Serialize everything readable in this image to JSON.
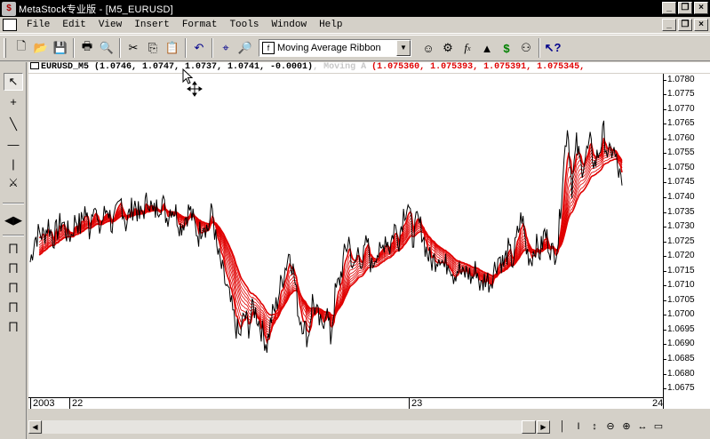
{
  "window": {
    "title": "MetaStock专业版 - [M5_EURUSD]"
  },
  "menu": [
    "File",
    "Edit",
    "View",
    "Insert",
    "Format",
    "Tools",
    "Window",
    "Help"
  ],
  "toolbar": {
    "indicator_select": "Moving Average Ribbon"
  },
  "chart": {
    "header": {
      "symbol": "EURUSD_M5",
      "ohlc": " (1.0746, 1.0747, 1.0737, 1.0741, -0.0001)",
      "indicator_name": ", Moving A",
      "indicator_values": " (1.075360, 1.075393, 1.075391, 1.075345,"
    },
    "y_ticks": [
      "1.0780",
      "1.0775",
      "1.0770",
      "1.0765",
      "1.0760",
      "1.0755",
      "1.0750",
      "1.0745",
      "1.0740",
      "1.0735",
      "1.0730",
      "1.0725",
      "1.0720",
      "1.0715",
      "1.0710",
      "1.0705",
      "1.0700",
      "1.0695",
      "1.0690",
      "1.0685",
      "1.0680",
      "1.0675"
    ],
    "x_ticks": [
      "2003",
      "22",
      "23",
      "24"
    ],
    "price_color": "#000000",
    "ribbon_color": "#e00000"
  },
  "chart_data": {
    "type": "line",
    "ylim": [
      1.0672,
      1.0782
    ],
    "series": [
      {
        "values": [
          1.0718,
          1.0726,
          1.0728,
          1.0727,
          1.0731,
          1.0726,
          1.0729,
          1.0732,
          1.0728,
          1.0727,
          1.0733,
          1.073,
          1.0736,
          1.0729,
          1.074,
          1.0728,
          1.0733,
          1.0737,
          1.073,
          1.0734,
          1.0739,
          1.0731,
          1.0735,
          1.0738,
          1.0733,
          1.0736,
          1.074,
          1.0734,
          1.0737,
          1.0739,
          1.0733,
          1.0737,
          1.0735,
          1.073,
          1.0733,
          1.0736,
          1.0731,
          1.0727,
          1.0732,
          1.0729,
          1.0736,
          1.0722,
          1.0716,
          1.071,
          1.0704,
          1.0697,
          1.0692,
          1.07,
          1.0696,
          1.0703,
          1.0699,
          1.0694,
          1.069,
          1.0699,
          1.0703,
          1.071,
          1.0716,
          1.0722,
          1.0713,
          1.07,
          1.0697,
          1.0692,
          1.0705,
          1.07,
          1.0695,
          1.0703,
          1.0692,
          1.0707,
          1.0712,
          1.072,
          1.0726,
          1.0714,
          1.0722,
          1.0718,
          1.0725,
          1.0716,
          1.0722,
          1.072,
          1.0727,
          1.0723,
          1.073,
          1.0726,
          1.0735,
          1.0738,
          1.0726,
          1.0732,
          1.0729,
          1.0722,
          1.0718,
          1.0719,
          1.0721,
          1.0716,
          1.0719,
          1.0714,
          1.0716,
          1.0713,
          1.0715,
          1.0712,
          1.0716,
          1.0709,
          1.0713,
          1.0711,
          1.0716,
          1.072,
          1.0717,
          1.0722,
          1.0718,
          1.0727,
          1.0734,
          1.0722,
          1.0719,
          1.0724,
          1.0721,
          1.0728,
          1.0724,
          1.072,
          1.0726,
          1.0748,
          1.0765,
          1.0744,
          1.0758,
          1.075,
          1.0754,
          1.0758,
          1.0751,
          1.0756,
          1.0762,
          1.0753,
          1.0757,
          1.075,
          1.0744
        ]
      }
    ]
  }
}
